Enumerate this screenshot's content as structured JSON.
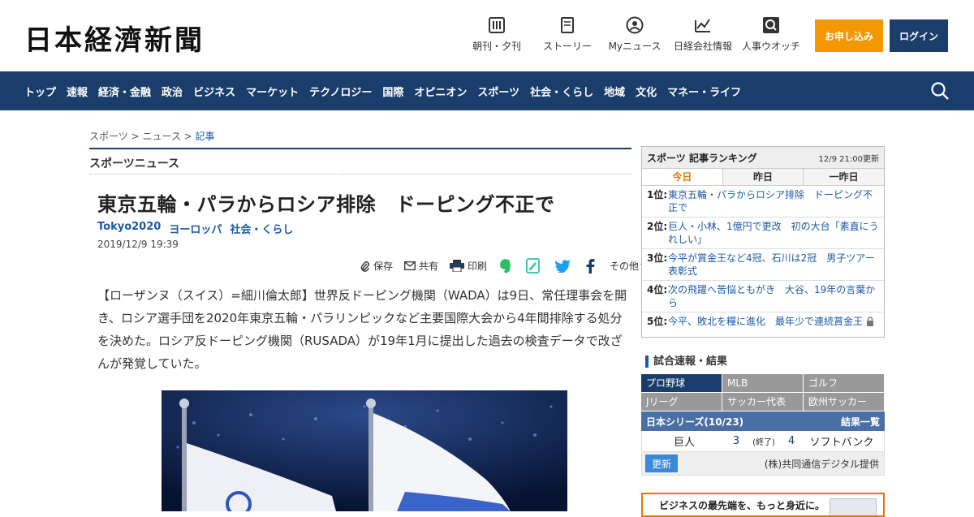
{
  "header": {
    "logo": "日本経濟新聞",
    "icons": [
      {
        "name": "morning-evening-icon",
        "label": "朝刊・夕刊"
      },
      {
        "name": "story-icon",
        "label": "ストーリー"
      },
      {
        "name": "my-news-icon",
        "label": "Myニュース"
      },
      {
        "name": "company-info-icon",
        "label": "日経会社情報"
      },
      {
        "name": "people-watch-icon",
        "label": "人事ウオッチ"
      }
    ],
    "apply_label": "お申し込み",
    "login_label": "ログイン"
  },
  "nav": {
    "items": [
      "トップ",
      "速報",
      "経済・金融",
      "政治",
      "ビジネス",
      "マーケット",
      "テクノロジー",
      "国際",
      "オピニオン",
      "スポーツ",
      "社会・くらし",
      "地域",
      "文化",
      "マネー・ライフ"
    ]
  },
  "breadcrumb": {
    "items": [
      "スポーツ",
      "ニュース",
      "記事"
    ],
    "sep": " > "
  },
  "section_title": "スポーツニュース",
  "article": {
    "headline": "東京五輪・パラからロシア排除　ドーピング不正で",
    "tags": [
      "Tokyo2020",
      "ヨーロッパ",
      "社会・くらし"
    ],
    "date": "2019/12/9 19:39",
    "share": {
      "save": "保存",
      "share": "共有",
      "print": "印刷",
      "more": "その他"
    },
    "body": "【ローザンヌ（スイス）=細川倫太郎】世界反ドーピング機関（WADA）は9日、常任理事会を開き、ロシア選手団を2020年東京五輪・パラリンピックなど主要国際大会から4年間排除する処分を決めた。ロシア反ドーピング機関（RUSADA）が19年1月に提出した過去の検査データで改ざんが発覚していた。"
  },
  "ranking": {
    "title": "スポーツ 記事ランキング",
    "updated": "12/9 21:00更新",
    "tabs": [
      "今日",
      "昨日",
      "一昨日"
    ],
    "items": [
      {
        "rank": "1位:",
        "text": "東京五輪・パラからロシア排除　ドーピング不正で"
      },
      {
        "rank": "2位:",
        "text": "巨人・小林、1億円で更改　初の大台「素直にうれしい」"
      },
      {
        "rank": "3位:",
        "text": "今平が賞金王など4冠、石川は2冠　男子ツアー表彰式"
      },
      {
        "rank": "4位:",
        "text": "次の飛躍へ苦悩ともがき　大谷、19年の言葉から"
      },
      {
        "rank": "5位:",
        "text": "今平、敗北を糧に進化　最年少で連続賞金王"
      }
    ]
  },
  "scores": {
    "title": "試合速報・結果",
    "categories": [
      "プロ野球",
      "MLB",
      "ゴルフ",
      "Jリーグ",
      "サッカー代表",
      "欧州サッカー"
    ],
    "series_label": "日本シリーズ(10/23)",
    "results_link": "結果一覧",
    "game": {
      "team1": "巨人",
      "score1": "3",
      "status": "(終了)",
      "score2": "4",
      "team2": "ソフトバンク"
    },
    "refresh_label": "更新",
    "source": "(株)共同通信デジタル提供"
  },
  "ad": {
    "text": "ビジネスの最先端を、もっと身近に。"
  },
  "colors": {
    "navy": "#1a3d6b",
    "orange": "#f39800",
    "link": "#1a5ba6"
  }
}
